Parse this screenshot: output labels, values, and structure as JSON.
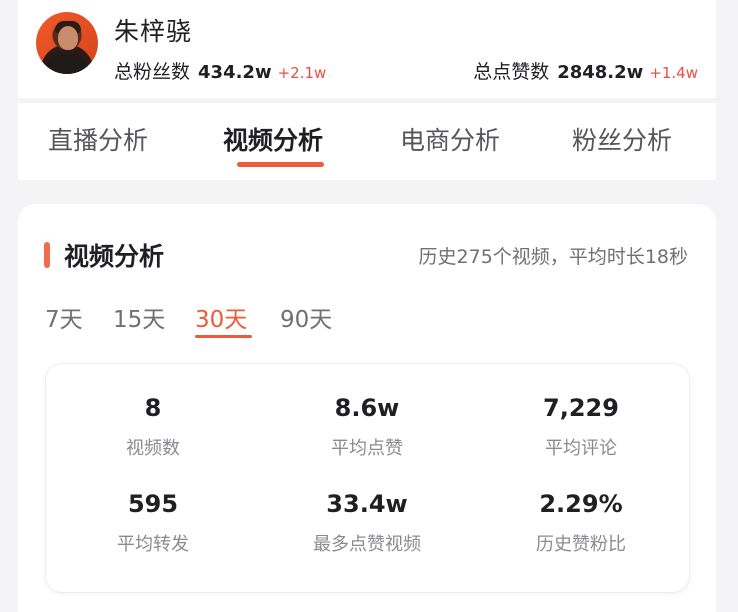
{
  "user": {
    "name": "朱梓骁",
    "fans_label": "总粉丝数",
    "fans_value": "434.2w",
    "fans_delta": "+2.1w",
    "likes_label": "总点赞数",
    "likes_value": "2848.2w",
    "likes_delta": "+1.4w"
  },
  "tabs": [
    {
      "label": "直播分析"
    },
    {
      "label": "视频分析"
    },
    {
      "label": "电商分析"
    },
    {
      "label": "粉丝分析"
    }
  ],
  "active_tab": "视频分析",
  "section": {
    "title": "视频分析",
    "summary": "历史275个视频，平均时长18秒"
  },
  "ranges": [
    {
      "label": "7天"
    },
    {
      "label": "15天"
    },
    {
      "label": "30天"
    },
    {
      "label": "90天"
    }
  ],
  "active_range": "30天",
  "stats": [
    {
      "value": "8",
      "label": "视频数"
    },
    {
      "value": "8.6w",
      "label": "平均点赞"
    },
    {
      "value": "7,229",
      "label": "平均评论"
    },
    {
      "value": "595",
      "label": "平均转发"
    },
    {
      "value": "33.4w",
      "label": "最多点赞视频"
    },
    {
      "value": "2.29%",
      "label": "历史赞粉比"
    }
  ],
  "colors": {
    "accent": "#ef5a3a",
    "delta": "#ef4d42"
  }
}
